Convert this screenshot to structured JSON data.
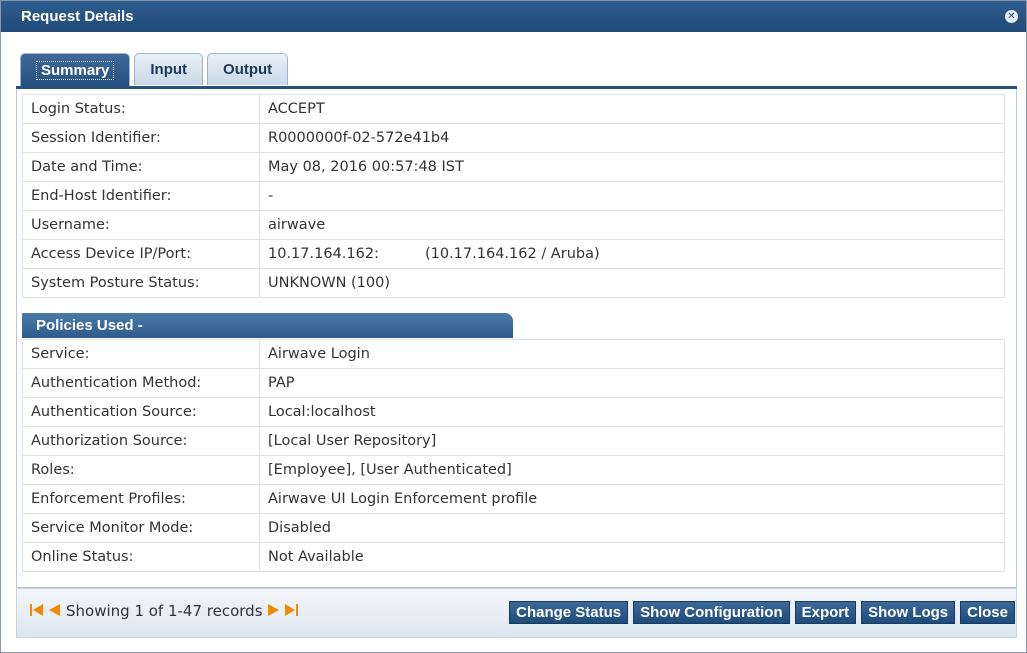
{
  "window": {
    "title": "Request Details"
  },
  "tabs": [
    {
      "label": "Summary",
      "active": true
    },
    {
      "label": "Input",
      "active": false
    },
    {
      "label": "Output",
      "active": false
    }
  ],
  "summary": {
    "rows": [
      {
        "key": "Login Status:",
        "value": "ACCEPT"
      },
      {
        "key": "Session Identifier:",
        "value": "R0000000f-02-572e41b4"
      },
      {
        "key": "Date and Time:",
        "value": "May 08, 2016 00:57:48 IST"
      },
      {
        "key": "End-Host Identifier:",
        "value": "-"
      },
      {
        "key": "Username:",
        "value": "airwave"
      },
      {
        "key": "Access Device IP/Port:",
        "value": "10.17.164.162:",
        "value_extra": "(10.17.164.162 / Aruba)"
      },
      {
        "key": "System Posture Status:",
        "value": "UNKNOWN (100)"
      }
    ]
  },
  "policies": {
    "heading": "Policies Used -",
    "rows": [
      {
        "key": "Service:",
        "value": "Airwave Login"
      },
      {
        "key": "Authentication Method:",
        "value": "PAP"
      },
      {
        "key": "Authentication Source:",
        "value": "Local:localhost"
      },
      {
        "key": "Authorization Source:",
        "value": "[Local User Repository]"
      },
      {
        "key": "Roles:",
        "value": "[Employee], [User Authenticated]"
      },
      {
        "key": "Enforcement Profiles:",
        "value": "Airwave UI Login Enforcement profile"
      },
      {
        "key": "Service Monitor Mode:",
        "value": "Disabled"
      },
      {
        "key": "Online Status:",
        "value": "Not Available"
      }
    ]
  },
  "footer": {
    "pager_text": "Showing 1 of 1-47 records",
    "buttons": {
      "change_status": "Change Status",
      "show_configuration": "Show Configuration",
      "export": "Export",
      "show_logs": "Show Logs",
      "close": "Close"
    }
  },
  "icons": {
    "first": "first-page-icon",
    "prev": "previous-icon",
    "next": "next-icon",
    "last": "last-page-icon",
    "close": "close-icon"
  },
  "colors": {
    "accent": "#25507f",
    "arrow": "#f08a00"
  }
}
